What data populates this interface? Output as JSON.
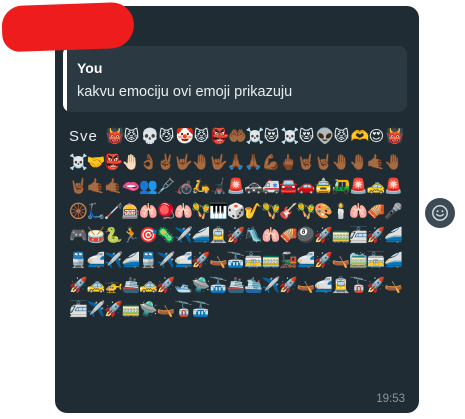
{
  "message": {
    "quote": {
      "author": "You",
      "text": "kakvu emociju ovi emoji prikazuju"
    },
    "prefix": "Sve",
    "emojis": "👹😾💀😼🤡😾👺🤲🏾☠️😻☠️😻👽😾🫶😍👹☠️🤝👺🤚🏻👌🏾✌🏾🤟🏾🤚🏾🤟🏾🙏🏾🙏🏾💪🏾🖕🏾🤘🏾🤘🏾🤚🏾🤚🏾🤙🏾🤚🏾🤘🏾🤙🏾🤙🏾🫦👥🩼🦽🛵🦼🚨🚓🚑🚘🚗🚖🛺🚨🚕🚨🛞🛴🦯🎰🫁🪀🫁🪇🎹🎲🎷🪇🎸🪇🎨🕯️🫁🪗🎤🎮🥁🐍🏃🎯🦠✈️🚄🚊🚀🛝🫁🪗🎱🚀🚃🚈🚀🚄🚆🚅✈️🚄🚆✈️🚅🚀🛶🚠🚋🚃🚂🚅🚀🛶🚞🚋🚄🚀🚕🚁🚢🚕🚀🛥️🛸🚠🚢🛳️✈️🚀🛶🚅🚊🚡🚀🛶🚈✈️🚀🚃🛸🛶🚡🚠",
    "time": "19:53"
  },
  "icons": {
    "react": "smiley-react-icon"
  },
  "colors": {
    "bubble": "#1f2c34",
    "quote_bg": "#2a3942",
    "quote_bar": "#ffffff",
    "time": "#8696a0",
    "redaction": "#ee1c1c"
  }
}
